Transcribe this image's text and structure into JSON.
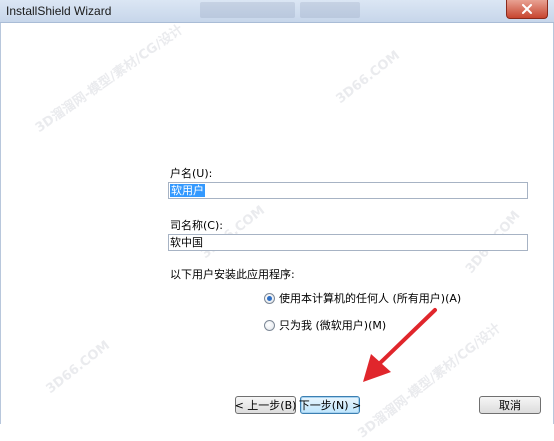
{
  "window": {
    "title": "InstallShield Wizard"
  },
  "form": {
    "username_label": "户名(U):",
    "username_value": "软用户",
    "org_label": "司名称(C):",
    "org_value": "软中国",
    "install_for_label": "以下用户安装此应用程序:",
    "options": [
      {
        "label": "使用本计算机的任何人 (所有用户)(A)",
        "selected": true
      },
      {
        "label": "只为我 (微软用户)(M)",
        "selected": false
      }
    ]
  },
  "buttons": {
    "back": "< 上一步(B)",
    "next": "下一步(N) >",
    "cancel": "取消"
  },
  "watermarks": [
    "3D66.COM",
    "3D溜溜网-模型/素材/CG/设计",
    "3D66.COM",
    "3D66.COM",
    "3D溜溜网-模型/素材/CG/设计",
    "3D66.COM"
  ],
  "colors": {
    "selection": "#3399ff",
    "annotation_arrow": "#e0262c",
    "title_gradient_top": "#dbe6f4"
  }
}
